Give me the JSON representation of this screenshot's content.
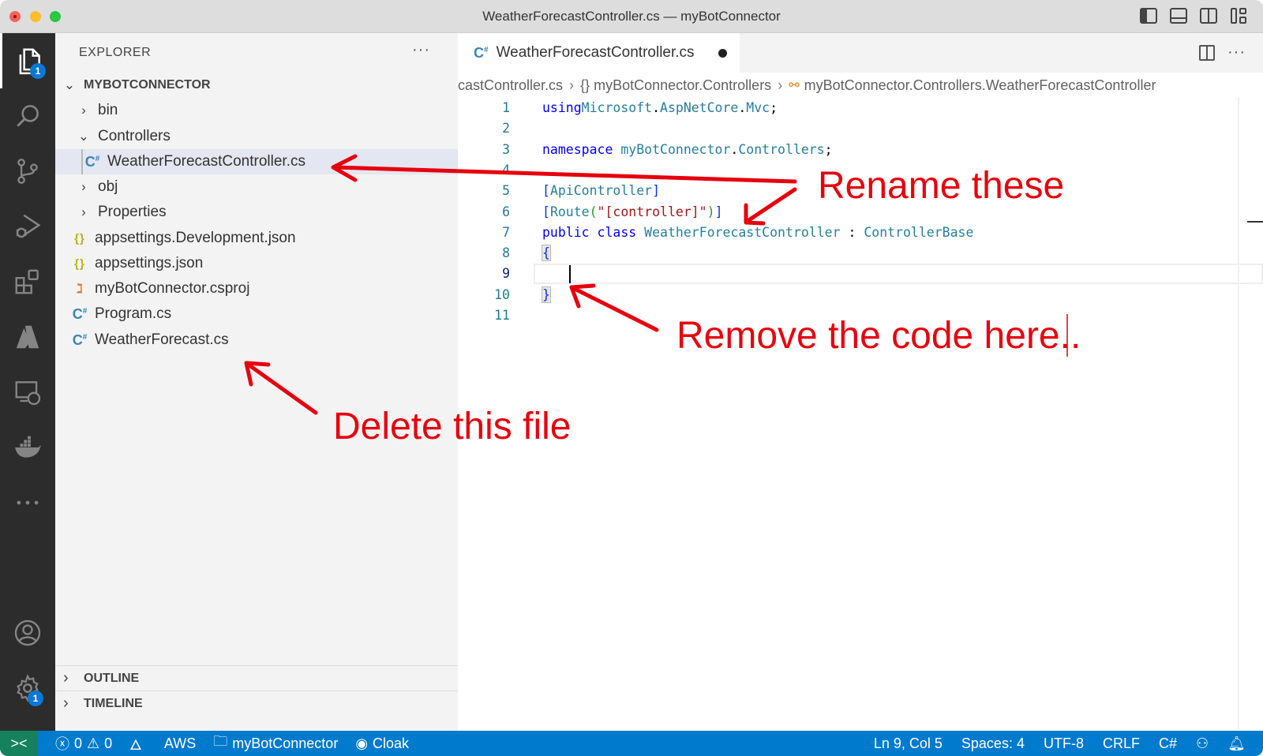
{
  "window": {
    "title": "WeatherForecastController.cs — myBotConnector"
  },
  "titlebar_icons": [
    "toggle-primary-sidebar-icon",
    "toggle-panel-icon",
    "toggle-secondary-sidebar-icon",
    "customize-layout-icon"
  ],
  "activity_bar": {
    "items": [
      {
        "name": "explorer",
        "icon": "files-icon",
        "badge": "1",
        "active": true
      },
      {
        "name": "search",
        "icon": "search-icon"
      },
      {
        "name": "source-control",
        "icon": "source-control-icon"
      },
      {
        "name": "run-debug",
        "icon": "run-debug-icon"
      },
      {
        "name": "extensions",
        "icon": "extensions-icon"
      },
      {
        "name": "azure",
        "icon": "azure-icon"
      },
      {
        "name": "remote-explorer",
        "icon": "remote-explorer-icon"
      },
      {
        "name": "docker",
        "icon": "docker-icon"
      },
      {
        "name": "more",
        "icon": "ellipsis-icon"
      }
    ],
    "bottom": [
      {
        "name": "accounts",
        "icon": "account-icon"
      },
      {
        "name": "manage",
        "icon": "gear-icon",
        "badge": "1"
      }
    ]
  },
  "sidebar": {
    "header": "EXPLORER",
    "more": "···",
    "project": "MYBOTCONNECTOR",
    "tree": [
      {
        "label": "bin",
        "type": "folder",
        "expanded": false
      },
      {
        "label": "Controllers",
        "type": "folder",
        "expanded": true
      },
      {
        "label": "WeatherForecastController.cs",
        "type": "cs",
        "selected": true
      },
      {
        "label": "obj",
        "type": "folder",
        "expanded": false
      },
      {
        "label": "Properties",
        "type": "folder",
        "expanded": false
      },
      {
        "label": "appsettings.Development.json",
        "type": "json"
      },
      {
        "label": "appsettings.json",
        "type": "json"
      },
      {
        "label": "myBotConnector.csproj",
        "type": "csproj"
      },
      {
        "label": "Program.cs",
        "type": "cs"
      },
      {
        "label": "WeatherForecast.cs",
        "type": "cs"
      }
    ],
    "sections": [
      "OUTLINE",
      "TIMELINE"
    ]
  },
  "editor": {
    "tab": {
      "label": "WeatherForecastController.cs",
      "dirty": true
    },
    "breadcrumbs": [
      "castController.cs",
      "{} myBotConnector.Controllers",
      "myBotConnector.Controllers.WeatherForecastController"
    ],
    "lines": [
      {
        "n": "1",
        "tokens": [
          [
            "kw",
            "using"
          ],
          [
            "",
            ""
          ],
          [
            "ns",
            "Microsoft"
          ],
          [
            "",
            "."
          ],
          [
            "ns",
            "AspNetCore"
          ],
          [
            "",
            "."
          ],
          [
            "ns",
            "Mvc"
          ],
          [
            "",
            ";"
          ]
        ]
      },
      {
        "n": "2",
        "tokens": []
      },
      {
        "n": "3",
        "tokens": [
          [
            "kw",
            "namespace"
          ],
          [
            "ns",
            "myBotConnector"
          ],
          [
            "",
            "."
          ],
          [
            "ns",
            "Controllers"
          ],
          [
            "",
            ";"
          ]
        ]
      },
      {
        "n": "4",
        "tokens": []
      },
      {
        "n": "5",
        "tokens": [
          [
            "bracket",
            "["
          ],
          [
            "attr",
            "ApiController"
          ],
          [
            "bracket",
            "]"
          ]
        ]
      },
      {
        "n": "6",
        "tokens": [
          [
            "bracket",
            "["
          ],
          [
            "attr",
            "Route"
          ],
          [
            "paren",
            "("
          ],
          [
            "str",
            "\"[controller]\""
          ],
          [
            "paren",
            ")"
          ],
          [
            "bracket",
            "]"
          ]
        ]
      },
      {
        "n": "7",
        "tokens": [
          [
            "kw",
            "public"
          ],
          [
            "kw",
            "class"
          ],
          [
            "type",
            "WeatherForecastController"
          ],
          [
            "",
            ":"
          ],
          [
            "type",
            "ControllerBase"
          ]
        ]
      },
      {
        "n": "8",
        "tokens": [
          [
            "bracket",
            "{"
          ]
        ]
      },
      {
        "n": "9",
        "tokens": []
      },
      {
        "n": "10",
        "tokens": [
          [
            "bracket",
            "}"
          ]
        ]
      },
      {
        "n": "11",
        "tokens": []
      }
    ],
    "current_line": "9"
  },
  "annotations": {
    "rename": "Rename these",
    "remove": "Remove the code here..",
    "delete": "Delete this file",
    "color": "#e6000e"
  },
  "statusbar": {
    "remote": "><",
    "errors": "0",
    "warnings": "0",
    "aws": "AWS",
    "folder": "myBotConnector",
    "cloak": "Cloak",
    "position": "Ln 9, Col 5",
    "spaces": "Spaces: 4",
    "encoding": "UTF-8",
    "eol": "CRLF",
    "language": "C#"
  }
}
